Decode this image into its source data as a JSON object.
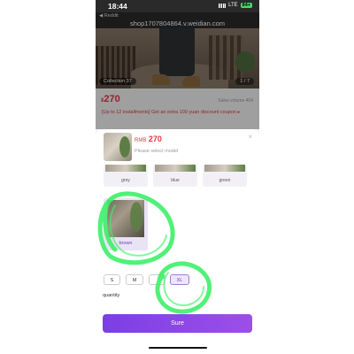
{
  "status_bar": {
    "time": "18:44",
    "network": "LTE",
    "battery": "84+"
  },
  "nav": {
    "back_label": "◀ Reddit",
    "url": "shop1707804864.v.weidian.com"
  },
  "hero": {
    "collection_tag": "Collection 37",
    "image_counter": "1 / 7"
  },
  "product": {
    "currency_symbol": "¥",
    "price": "270",
    "sales_volume": "Sales volume 404",
    "promo_text": "[Up to 12 installments] Get an extra 100 yuan discount coupon ▸"
  },
  "sheet": {
    "currency": "RMB",
    "price": "270",
    "select_prompt": "Please select model",
    "close_glyph": "×",
    "colors": [
      {
        "label": "grey"
      },
      {
        "label": "blue"
      },
      {
        "label": "green"
      },
      {
        "label": "brown"
      }
    ],
    "sizes": [
      {
        "label": "S"
      },
      {
        "label": "M"
      },
      {
        "label": "L"
      },
      {
        "label": "XL"
      }
    ],
    "quantity_label": "quantity",
    "confirm_label": "Sure"
  },
  "colors": {
    "accent": "#7b3fe4",
    "price_red": "#e0383e",
    "highlight_green": "#3ff06a"
  }
}
